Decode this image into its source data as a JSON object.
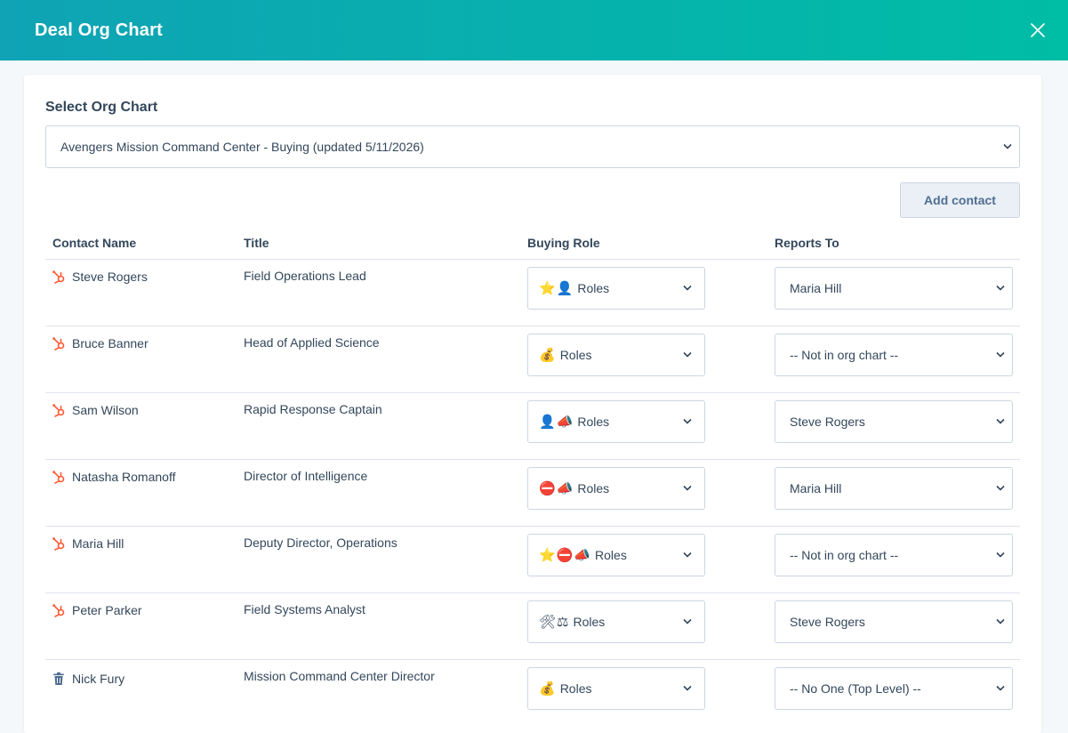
{
  "header": {
    "title": "Deal Org Chart"
  },
  "org_select": {
    "label": "Select Org Chart",
    "value": "Avengers Mission Command Center - Buying (updated 5/11/2026)"
  },
  "toolbar": {
    "add_contact_label": "Add contact"
  },
  "table": {
    "columns": [
      "Contact Name",
      "Title",
      "Buying Role",
      "Reports To"
    ],
    "rows": [
      {
        "name": "Steve Rogers",
        "title": "Field Operations Lead",
        "role_icons": "⭐👤",
        "role_label": "Roles",
        "reports_to": "Maria Hill",
        "icon": "hubspot-sprocket-icon"
      },
      {
        "name": "Bruce Banner",
        "title": "Head of Applied Science",
        "role_icons": "💰",
        "role_label": "Roles",
        "reports_to": "-- Not in org chart --",
        "icon": "hubspot-sprocket-icon"
      },
      {
        "name": "Sam Wilson",
        "title": "Rapid Response Captain",
        "role_icons": "👤📣",
        "role_label": "Roles",
        "reports_to": "Steve Rogers",
        "icon": "hubspot-sprocket-icon"
      },
      {
        "name": "Natasha Romanoff",
        "title": "Director of Intelligence",
        "role_icons": "⛔📣",
        "role_label": "Roles",
        "reports_to": "Maria Hill",
        "icon": "hubspot-sprocket-icon"
      },
      {
        "name": "Maria Hill",
        "title": "Deputy Director, Operations",
        "role_icons": "⭐⛔📣",
        "role_label": "Roles",
        "reports_to": "-- Not in org chart --",
        "icon": "hubspot-sprocket-icon"
      },
      {
        "name": "Peter Parker",
        "title": "Field Systems Analyst",
        "role_icons": "🛠⚖",
        "role_label": "Roles",
        "reports_to": "Steve Rogers",
        "icon": "hubspot-sprocket-icon"
      },
      {
        "name": "Nick Fury",
        "title": "Mission Command Center Director",
        "role_icons": "💰",
        "role_label": "Roles",
        "reports_to": "-- No One (Top Level) --",
        "icon": "trash-icon"
      }
    ]
  },
  "colors": {
    "accent": "#00bda5",
    "hubspot_orange": "#ff5c35",
    "text": "#33475b"
  }
}
